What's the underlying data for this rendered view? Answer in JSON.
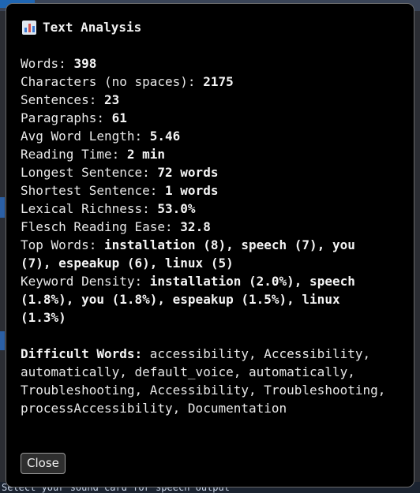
{
  "background": {
    "bottom_text": "Select your sound card for speech output"
  },
  "dialog": {
    "title": "Text Analysis",
    "icon": "bar-chart-icon",
    "stats": [
      {
        "label": "Words: ",
        "value": "398"
      },
      {
        "label": "Characters (no spaces): ",
        "value": "2175"
      },
      {
        "label": "Sentences: ",
        "value": "23"
      },
      {
        "label": "Paragraphs: ",
        "value": "61"
      },
      {
        "label": "Avg Word Length: ",
        "value": "5.46"
      },
      {
        "label": "Reading Time: ",
        "value": "2 min"
      },
      {
        "label": "Longest Sentence: ",
        "value": "72 words"
      },
      {
        "label": "Shortest Sentence: ",
        "value": "1 words"
      },
      {
        "label": "Lexical Richness: ",
        "value": "53.0%"
      },
      {
        "label": "Flesch Reading Ease: ",
        "value": "32.8"
      }
    ],
    "top_words_label": "Top Words: ",
    "top_words_value": "installation (8), speech (7), you (7), espeakup (6), linux (5)",
    "keyword_density_label": "Keyword Density: ",
    "keyword_density_value": "installation (2.0%), speech (1.8%), you (1.8%), espeakup (1.5%), linux (1.3%)",
    "difficult_words_label": "Difficult Words:",
    "difficult_words_value": " accessibility, Accessibility, automatically, default_voice, automatically, Troubleshooting, Accessibility, Troubleshooting, processAccessibility, Documentation",
    "close_label": "Close"
  }
}
